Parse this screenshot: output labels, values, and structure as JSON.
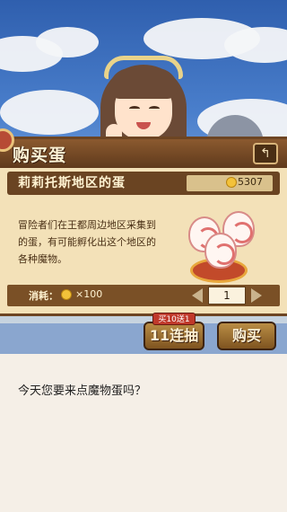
{
  "panel": {
    "title": "购买蛋",
    "back_icon": "return-arrow-icon",
    "region_name": "莉莉托斯地区的蛋",
    "gold": "5307",
    "description_lines": [
      "冒险者们在王都周边地区采集到",
      "的蛋，有可能孵化出这个地区的",
      "各种魔物。"
    ],
    "cost_label": "消耗：",
    "cost_value": "×100",
    "quantity": "1"
  },
  "actions": {
    "badge": "买10送1",
    "multi_draw": "11连抽",
    "buy": "购买"
  },
  "dialogue": {
    "text": "今天您要来点魔物蛋吗？"
  },
  "colors": {
    "panel_bg": "#f3e1b8",
    "header_brown": "#6a4422",
    "badge_red": "#c0392b",
    "coin_gold": "#f3c23a"
  }
}
